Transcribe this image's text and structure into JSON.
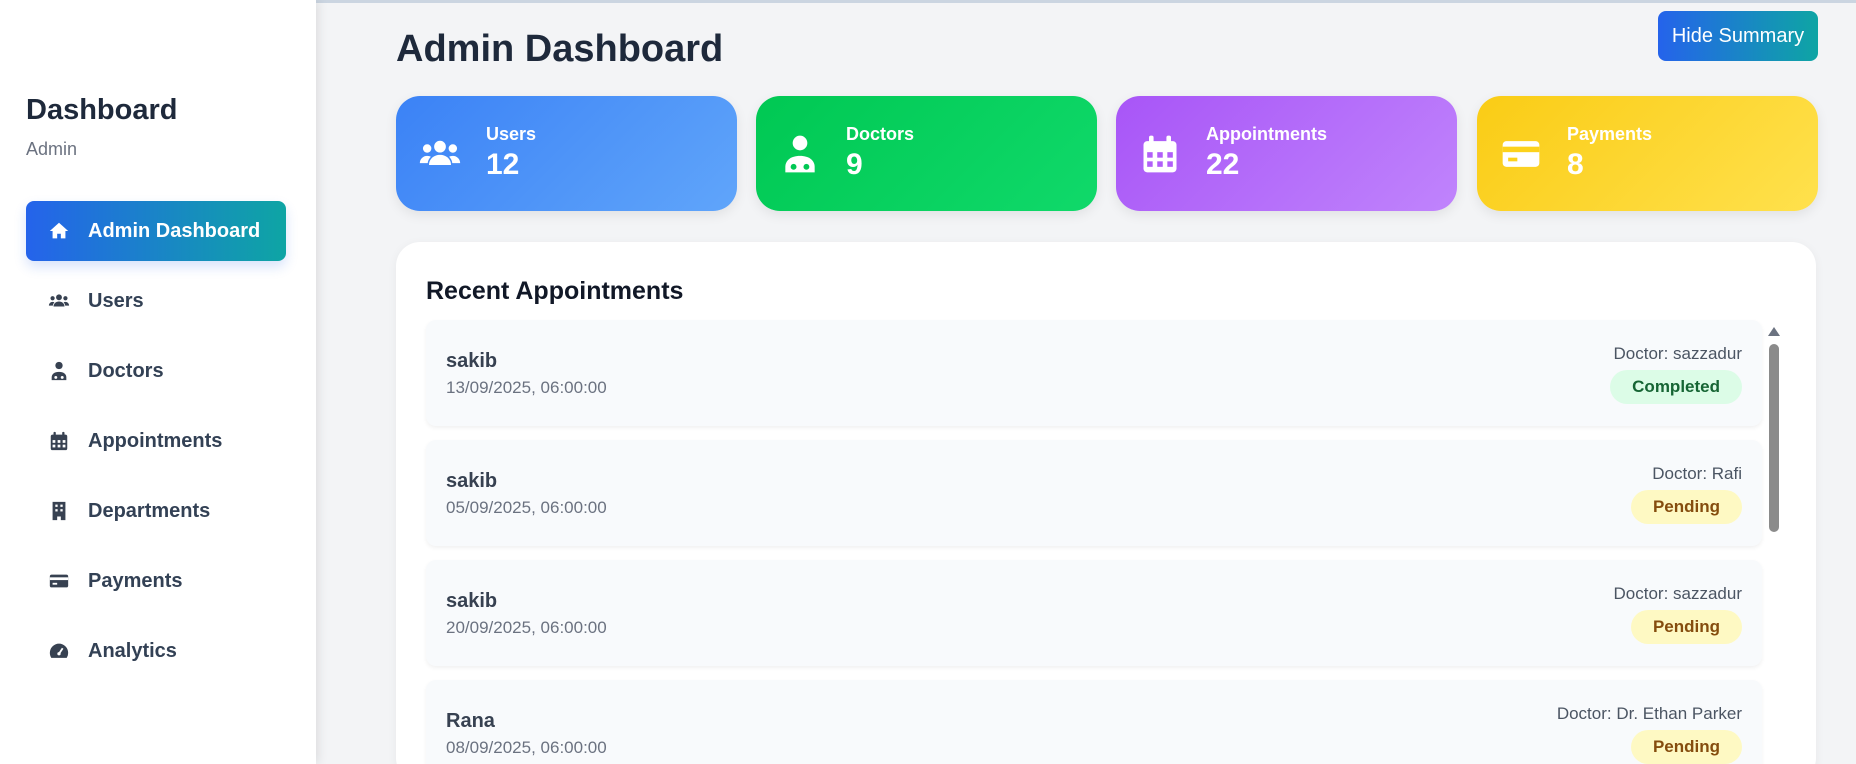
{
  "sidebar": {
    "title": "Dashboard",
    "subtitle": "Admin",
    "items": [
      {
        "label": "Admin Dashboard",
        "icon": "home-icon",
        "active": true
      },
      {
        "label": "Users",
        "icon": "users-icon"
      },
      {
        "label": "Doctors",
        "icon": "doctor-icon"
      },
      {
        "label": "Appointments",
        "icon": "calendar-icon"
      },
      {
        "label": "Departments",
        "icon": "building-icon"
      },
      {
        "label": "Payments",
        "icon": "credit-card-icon"
      },
      {
        "label": "Analytics",
        "icon": "gauge-icon"
      }
    ]
  },
  "header": {
    "title": "Admin Dashboard",
    "hide_summary_label": "Hide Summary"
  },
  "cards": [
    {
      "label": "Users",
      "value": "12",
      "icon": "users-icon",
      "gradient": [
        "#3b82f6",
        "#60a5fa"
      ]
    },
    {
      "label": "Doctors",
      "value": "9",
      "icon": "doctor-icon",
      "gradient": [
        "#00c853",
        "#10d96a"
      ]
    },
    {
      "label": "Appointments",
      "value": "22",
      "icon": "calendar-icon",
      "gradient": [
        "#a855f7",
        "#c084fc"
      ]
    },
    {
      "label": "Payments",
      "value": "8",
      "icon": "credit-card-icon",
      "gradient": [
        "#facc15",
        "#ffe14d"
      ]
    }
  ],
  "recent": {
    "title": "Recent Appointments",
    "rows": [
      {
        "patient": "sakib",
        "datetime": "13/09/2025, 06:00:00",
        "doctor": "Doctor: sazzadur",
        "status": "Completed"
      },
      {
        "patient": "sakib",
        "datetime": "05/09/2025, 06:00:00",
        "doctor": "Doctor: Rafi",
        "status": "Pending"
      },
      {
        "patient": "sakib",
        "datetime": "20/09/2025, 06:00:00",
        "doctor": "Doctor: sazzadur",
        "status": "Pending"
      },
      {
        "patient": "Rana",
        "datetime": "08/09/2025, 06:00:00",
        "doctor": "Doctor: Dr. Ethan Parker",
        "status": "Pending"
      }
    ]
  },
  "colors": {
    "accent_gradient": [
      "#2563eb",
      "#0ea5a4"
    ],
    "completed_bg": "#dcfce7",
    "pending_bg": "#fef9c3"
  }
}
